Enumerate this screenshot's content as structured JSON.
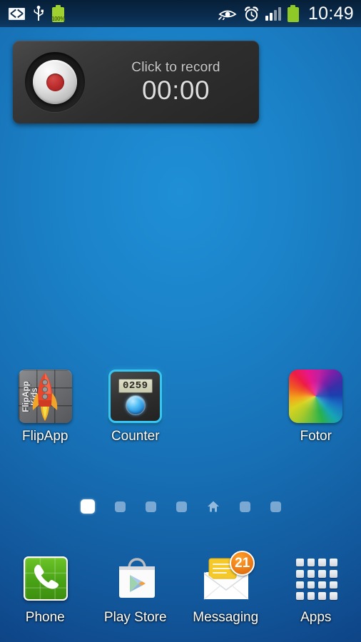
{
  "statusbar": {
    "left_icons": [
      {
        "name": "email-icon",
        "label": "envelope"
      },
      {
        "name": "usb-icon",
        "label": "usb"
      },
      {
        "name": "battery-percent-icon",
        "label": "battery",
        "percent": "100%"
      }
    ],
    "right_icons": [
      {
        "name": "smart-stay-eye-icon",
        "label": "eye"
      },
      {
        "name": "alarm-clock-icon",
        "label": "alarm"
      },
      {
        "name": "signal-bars-icon",
        "label": "signal",
        "bars_filled": 2,
        "bars_total": 4
      },
      {
        "name": "battery-icon",
        "label": "battery"
      }
    ],
    "clock": "10:49",
    "background": "#0a2c4e"
  },
  "widget": {
    "name": "voice-recorder-widget",
    "prompt": "Click to record",
    "timer": "00:00",
    "record_button": "record-button",
    "accent": "#bf2f2f",
    "background": "#2e2e2e"
  },
  "apps": [
    {
      "name": "flipapp",
      "label": "FlipApp",
      "icon": "flipapp-icon",
      "icon_text": "FlipApp Kids"
    },
    {
      "name": "counter",
      "label": "Counter",
      "icon": "counter-icon",
      "display_value": "0259",
      "accent": "#35c6f4"
    },
    {
      "name": "empty-slot",
      "label": "",
      "icon": ""
    },
    {
      "name": "fotor",
      "label": "Fotor",
      "icon": "fotor-icon"
    }
  ],
  "page_indicator": {
    "total": 7,
    "active_index": 0,
    "home_index": 4,
    "dots": [
      {
        "name": "page-dot-1",
        "state": "active"
      },
      {
        "name": "page-dot-2",
        "state": "inactive"
      },
      {
        "name": "page-dot-3",
        "state": "inactive"
      },
      {
        "name": "page-dot-4",
        "state": "inactive"
      },
      {
        "name": "page-dot-home",
        "state": "home"
      },
      {
        "name": "page-dot-6",
        "state": "inactive"
      },
      {
        "name": "page-dot-7",
        "state": "inactive"
      }
    ]
  },
  "dock": [
    {
      "name": "phone",
      "label": "Phone",
      "icon": "phone-icon",
      "accent": "#49a315"
    },
    {
      "name": "play-store",
      "label": "Play Store",
      "icon": "play-store-icon"
    },
    {
      "name": "messaging",
      "label": "Messaging",
      "icon": "messaging-icon",
      "badge": "21",
      "badge_color": "#f2841a"
    },
    {
      "name": "apps",
      "label": "Apps",
      "icon": "apps-grid-icon"
    }
  ],
  "wallpaper": {
    "name": "blue-gradient-wallpaper",
    "color_top": "#1f8fd6",
    "color_bottom": "#0d4183"
  }
}
